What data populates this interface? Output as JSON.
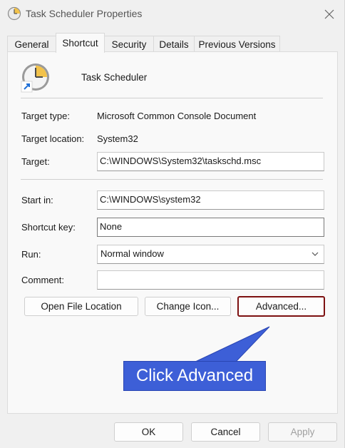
{
  "window": {
    "title": "Task Scheduler Properties"
  },
  "tabs": [
    {
      "label": "General"
    },
    {
      "label": "Shortcut",
      "active": true
    },
    {
      "label": "Security"
    },
    {
      "label": "Details"
    },
    {
      "label": "Previous Versions"
    }
  ],
  "shortcut": {
    "app_name": "Task Scheduler",
    "target_type_label": "Target type:",
    "target_type_value": "Microsoft Common Console Document",
    "target_location_label": "Target location:",
    "target_location_value": "System32",
    "target_label": "Target:",
    "target_value": "C:\\WINDOWS\\System32\\taskschd.msc",
    "start_in_label": "Start in:",
    "start_in_value": "C:\\WINDOWS\\system32",
    "shortcut_key_label": "Shortcut key:",
    "shortcut_key_value": "None",
    "run_label": "Run:",
    "run_value": "Normal window",
    "comment_label": "Comment:",
    "comment_value": "",
    "open_file_location_label": "Open File Location",
    "change_icon_label": "Change Icon...",
    "advanced_label": "Advanced..."
  },
  "callout": {
    "text": "Click Advanced"
  },
  "footer": {
    "ok_label": "OK",
    "cancel_label": "Cancel",
    "apply_label": "Apply"
  },
  "colors": {
    "highlight_border": "#7d1111",
    "callout_fill": "#3d5fd7"
  }
}
